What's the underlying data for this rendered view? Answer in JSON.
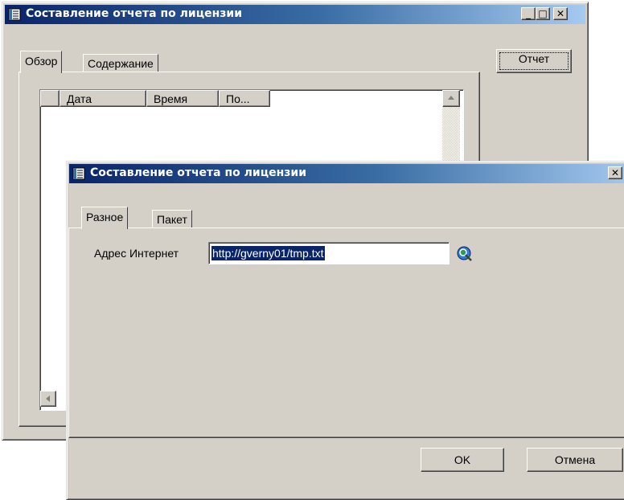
{
  "back_window": {
    "title": "Составление отчета по лицензии",
    "tabs": [
      "Обзор",
      "Содержание"
    ],
    "report_button": "Отчет",
    "columns": [
      "Дата",
      "Время",
      "По..."
    ],
    "controls": [
      "minimize",
      "maximize",
      "close"
    ]
  },
  "front_window": {
    "title": "Составление отчета по лицензии",
    "tabs": [
      "Разное",
      "Пакет"
    ],
    "internet_address_label": "Адрес Интернет",
    "internet_address_value": "http://gverny01/tmp.txt",
    "ok_button": "OK",
    "cancel_button": "Отмена"
  },
  "icons": {
    "app": "report-window-icon",
    "browse": "globe-search-icon"
  },
  "colors": {
    "face": "#d4d0c8",
    "title_active": "#0a246a",
    "title_fade": "#a6caf0",
    "selection": "#0a246a"
  }
}
